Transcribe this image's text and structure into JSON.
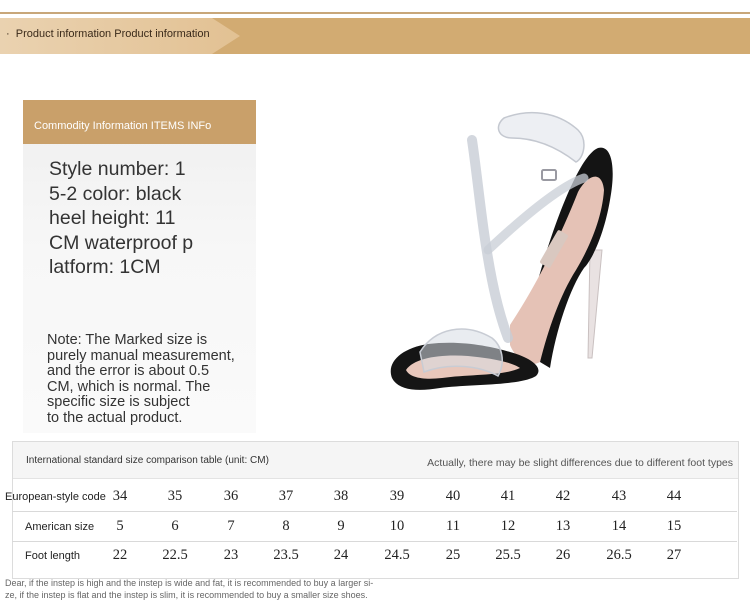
{
  "banner": {
    "bullet": "·",
    "title": "Product information Product information"
  },
  "info": {
    "header": "Commodity Information ITEMS INFo",
    "specs": [
      "Style number: 1",
      "5-2 color: black",
      "heel height: 11",
      "CM waterproof p",
      "latform: 1CM"
    ],
    "note": [
      "Note: The Marked size is",
      "purely manual measurement,",
      "and the error is about 0.5",
      "CM, which is normal. The",
      "specific size is subject",
      "to the actual product."
    ]
  },
  "size_table": {
    "title": "International standard size comparison table (unit: CM)",
    "remark": "Actually, there may be slight differences due to different foot types",
    "rows": [
      {
        "label": "European-style code",
        "values": [
          "34",
          "35",
          "36",
          "37",
          "38",
          "39",
          "40",
          "41",
          "42",
          "43",
          "44"
        ]
      },
      {
        "label": "American size",
        "values": [
          "5",
          "6",
          "7",
          "8",
          "9",
          "10",
          "11",
          "12",
          "13",
          "14",
          "15"
        ]
      },
      {
        "label": "Foot length",
        "values": [
          "22",
          "22.5",
          "23",
          "23.5",
          "24",
          "24.5",
          "25",
          "25.5",
          "26",
          "26.5",
          "27"
        ]
      }
    ]
  },
  "footnote": [
    "Dear, if the instep is high and the instep is wide and fat, it is recommended to buy a larger si-",
    "ze, if the instep is flat and the instep is slim, it is recommended to buy a smaller size shoes."
  ],
  "colors": {
    "accent": "#c9a06a",
    "banner": "#d2ab72"
  },
  "icons": {
    "product": "sandal-image"
  }
}
